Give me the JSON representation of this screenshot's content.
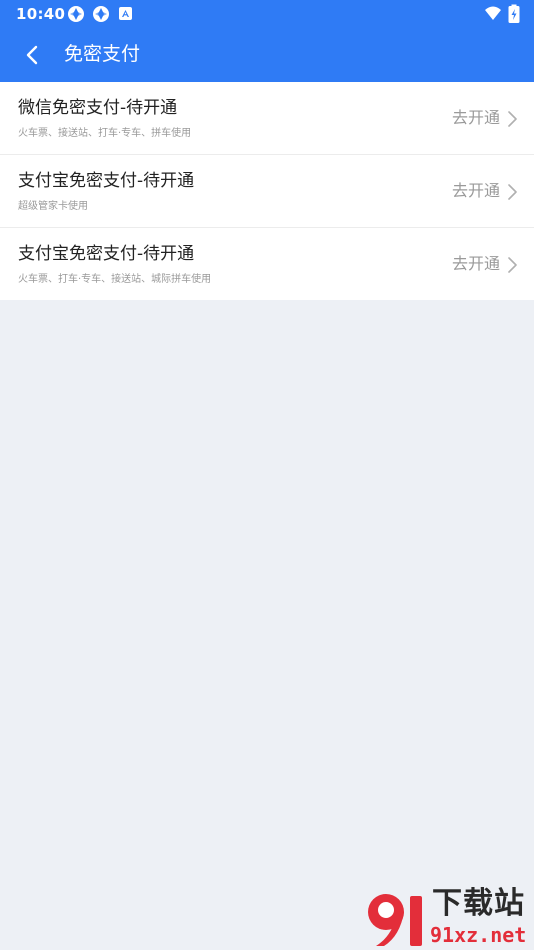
{
  "status_bar": {
    "time": "10:40",
    "left_icons": [
      "sync-icon",
      "sync-icon",
      "notification-icon"
    ],
    "right_icons": [
      "wifi-icon",
      "battery-charging-icon"
    ]
  },
  "header": {
    "title": "免密支付",
    "back_icon": "back-arrow-icon",
    "background": "#2f7bf5"
  },
  "list": {
    "items": [
      {
        "title": "微信免密支付-待开通",
        "subtitle": "火车票、接送站、打车·专车、拼车使用",
        "action": "去开通"
      },
      {
        "title": "支付宝免密支付-待开通",
        "subtitle": "超级管家卡使用",
        "action": "去开通"
      },
      {
        "title": "支付宝免密支付-待开通",
        "subtitle": "火车票、打车·专车、接送站、城际拼车使用",
        "action": "去开通"
      }
    ]
  },
  "watermark": {
    "logo_text": "9l",
    "text_top": "下载站",
    "text_bottom": "91xz.net"
  }
}
